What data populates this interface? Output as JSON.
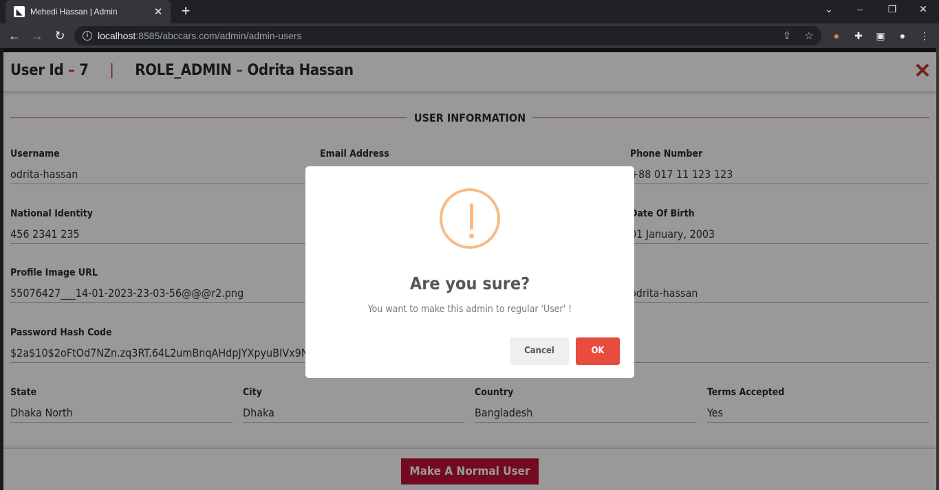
{
  "browser": {
    "tab_title": "Mehedi Hassan | Admin",
    "tab_favicon": "abc-cars-logo",
    "url_host": "localhost",
    "url_rest": ":8585/abccars.com/admin/admin-users"
  },
  "header": {
    "user_id_label": "User Id",
    "separator": "–",
    "user_id_value": "7",
    "divider": "|",
    "role": "ROLE_ADMIN",
    "name": "Odrita Hassan",
    "close_glyph": "✕"
  },
  "section": {
    "title": "USER INFORMATION"
  },
  "fields": {
    "username": {
      "label": "Username",
      "value": "odrita-hassan"
    },
    "email": {
      "label": "Email Address",
      "value": ""
    },
    "phone": {
      "label": "Phone Number",
      "value": "+88 017 11 123 123"
    },
    "national_id": {
      "label": "National Identity",
      "value": "456 2341 235"
    },
    "dob": {
      "label": "Date Of Birth",
      "value": "01 January, 2003"
    },
    "profile_image": {
      "label": "Profile Image URL",
      "value": "55076427___14-01-2023-23-03-56@@@r2.png"
    },
    "third_row_right": {
      "value": "odrita-hassan"
    },
    "password_hash": {
      "label": "Password Hash Code",
      "value": "$2a$10$2oFtOd7NZn.zq3RT.64L2umBnqAHdpJYXpyuBIVx9N"
    },
    "state": {
      "label": "State",
      "value": "Dhaka North"
    },
    "city": {
      "label": "City",
      "value": "Dhaka"
    },
    "country": {
      "label": "Country",
      "value": "Bangladesh"
    },
    "terms": {
      "label": "Terms Accepted",
      "value": "Yes"
    }
  },
  "footer": {
    "make_normal_label": "Make A Normal User"
  },
  "modal": {
    "icon": "warning-icon",
    "title": "Are you sure?",
    "text": "You want to make this admin to regular 'User' !",
    "cancel_label": "Cancel",
    "ok_label": "OK"
  },
  "colors": {
    "accent": "#c0392b",
    "primary_button": "#c0123a",
    "ok_button": "#e74c3c",
    "warning": "#f8bb86"
  }
}
